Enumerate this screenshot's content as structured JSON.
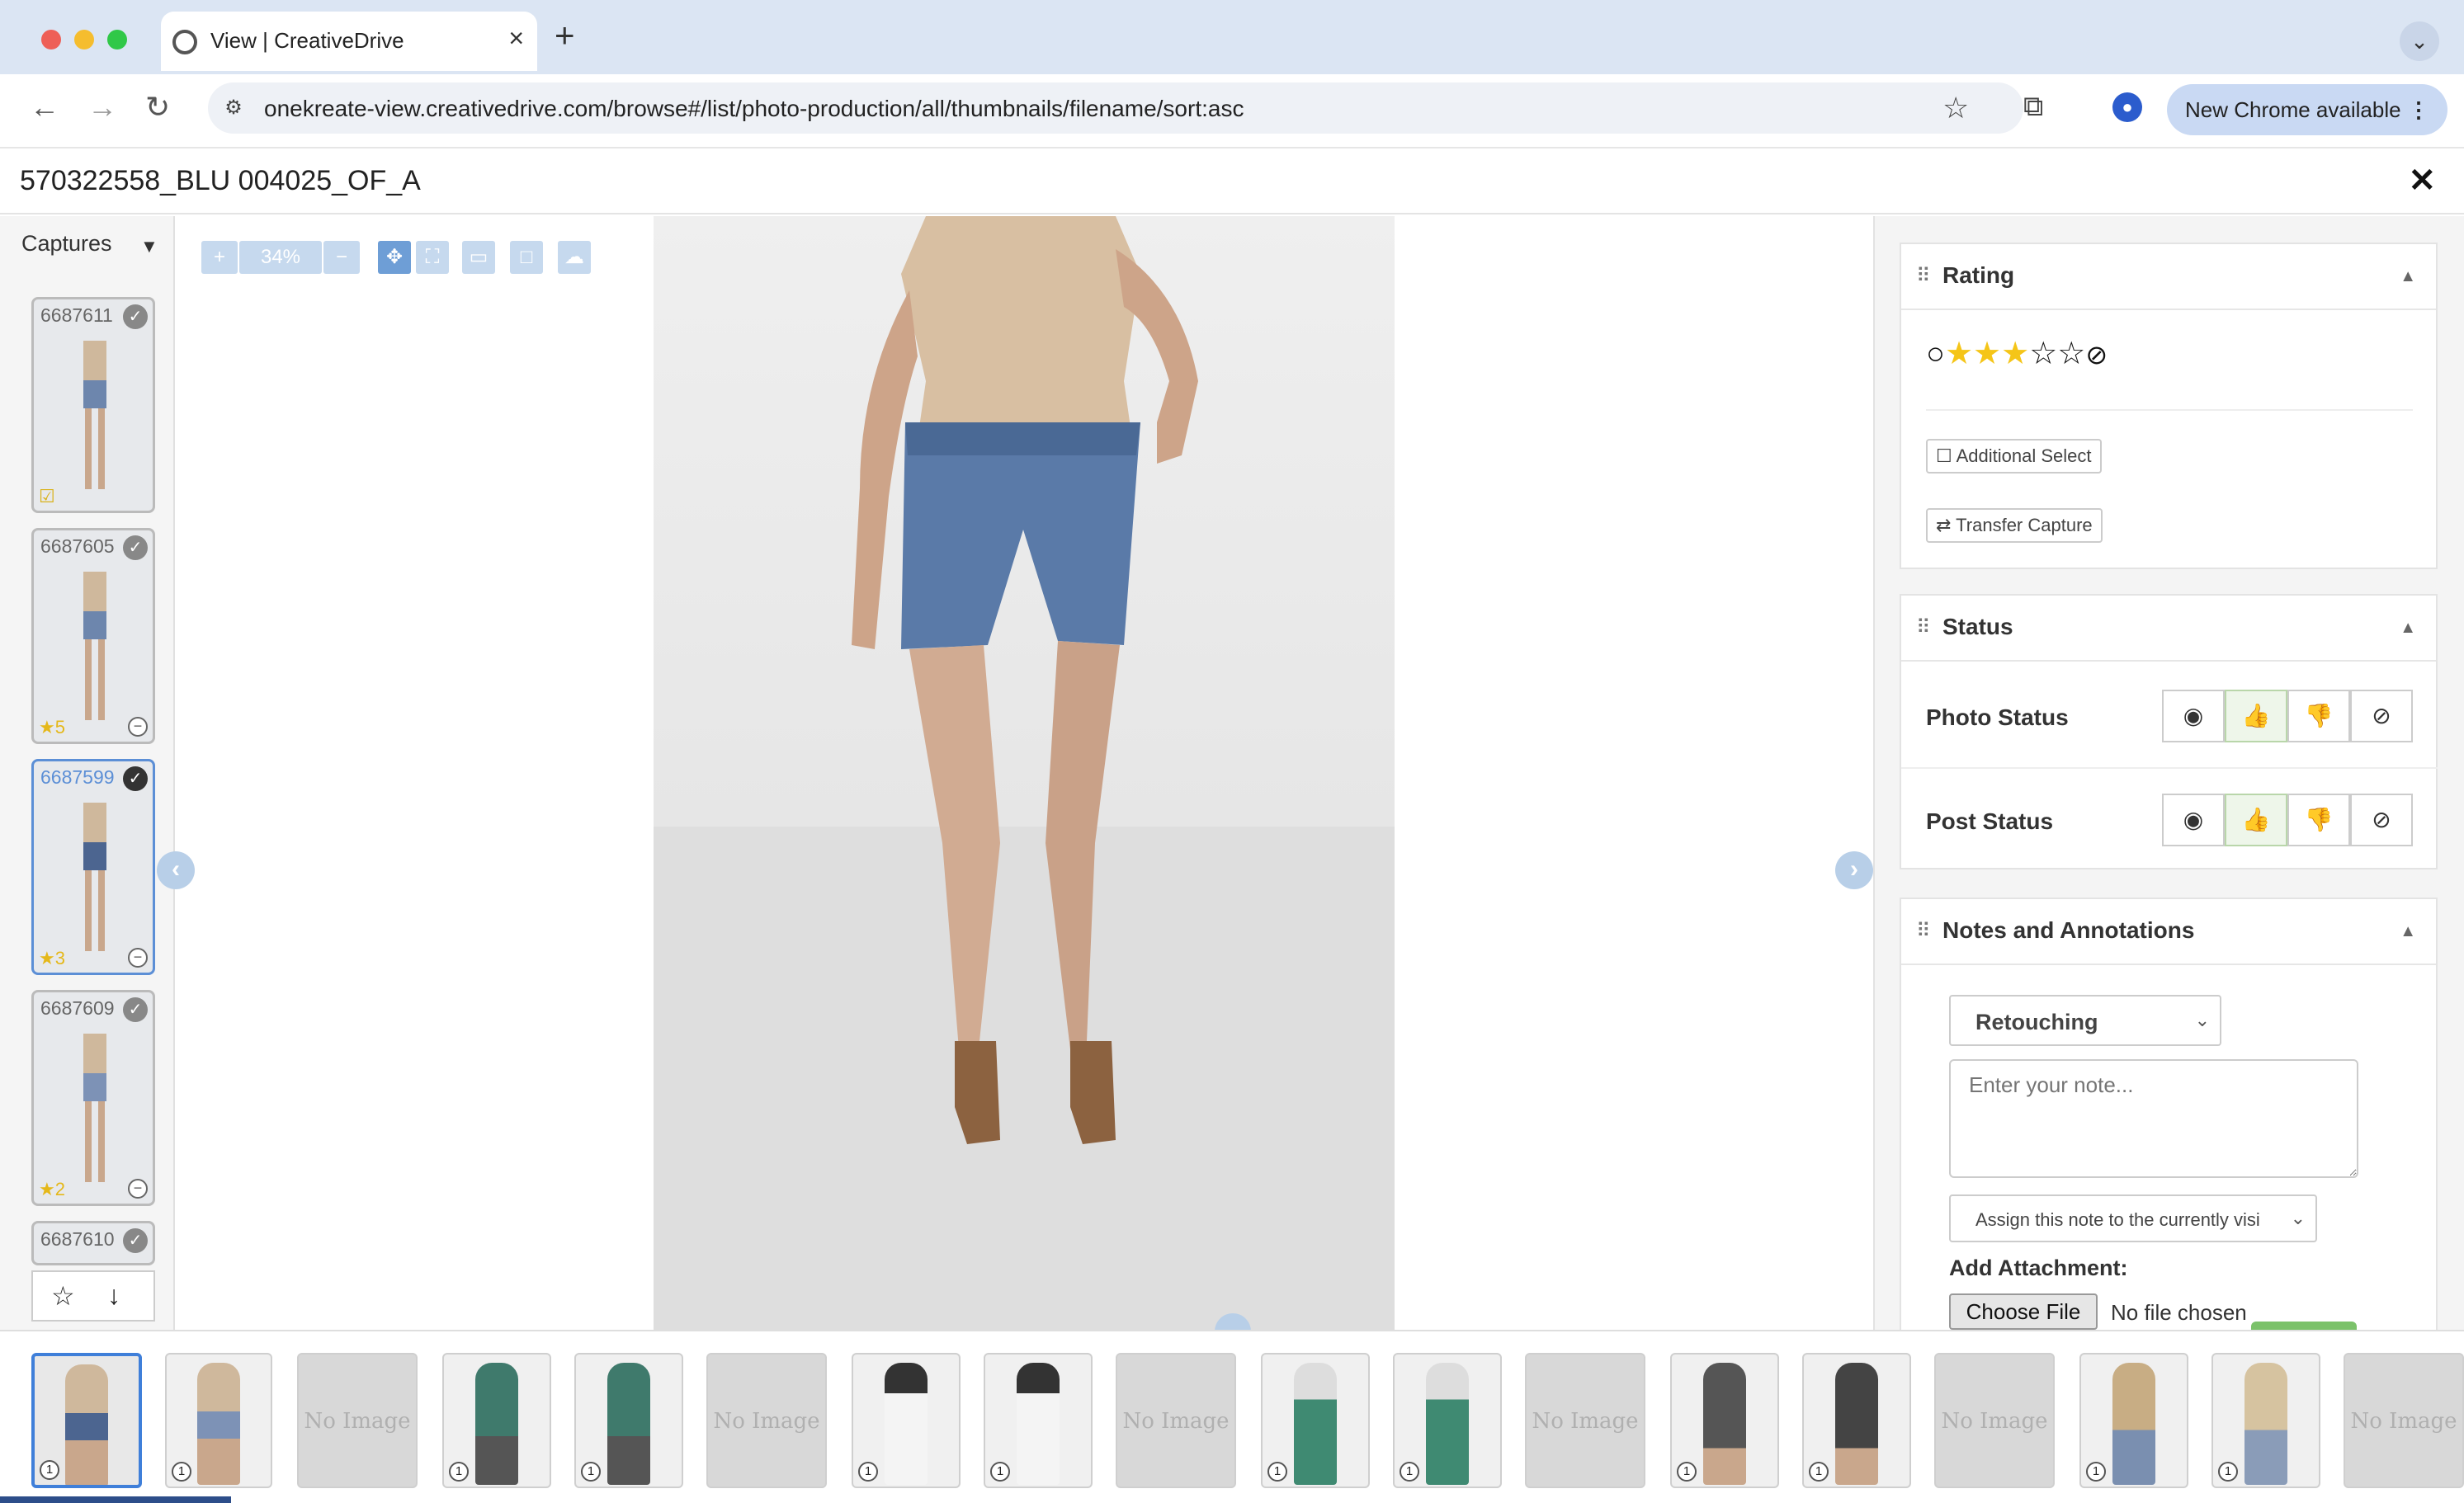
{
  "browser": {
    "tab_title": "View | CreativeDrive",
    "new_tab": "+",
    "url": "onekreate-view.creativedrive.com/browse#/list/photo-production/all/thumbnails/filename/sort:asc",
    "new_chrome_label": "New Chrome available"
  },
  "viewer": {
    "asset_title": "570322558_BLU 004025_OF_A",
    "zoom_level": "34%"
  },
  "captures": {
    "dropdown_label": "Captures",
    "thumbs": [
      {
        "id": "6687611",
        "stars": ""
      },
      {
        "id": "6687605",
        "stars": "5"
      },
      {
        "id": "6687599",
        "stars": "3"
      },
      {
        "id": "6687609",
        "stars": "2"
      },
      {
        "id": "6687610",
        "stars": ""
      }
    ]
  },
  "rating": {
    "title": "Rating",
    "value": 3,
    "max": 5,
    "additional_select": "Additional Select",
    "transfer_capture": "Transfer Capture"
  },
  "status": {
    "title": "Status",
    "photo_status_label": "Photo Status",
    "post_status_label": "Post Status"
  },
  "notes": {
    "title": "Notes and Annotations",
    "category": "Retouching",
    "note_placeholder": "Enter your note...",
    "assign_option": "Assign this note to the currently visi",
    "attachment_label": "Add Attachment:",
    "choose_file": "Choose File",
    "no_file": "No file chosen"
  },
  "filmstrip": {
    "no_image_text": "No Image",
    "items": [
      "1",
      "1",
      "",
      "1",
      "1",
      "",
      "1",
      "1",
      "",
      "1",
      "1",
      "",
      "1",
      "1",
      "",
      "1",
      "1",
      ""
    ]
  },
  "colors": {
    "accent": "#5c8fd6",
    "selected_border": "#3f7fd9",
    "approve_green": "#6aa84f",
    "star_gold": "#f5c518"
  }
}
